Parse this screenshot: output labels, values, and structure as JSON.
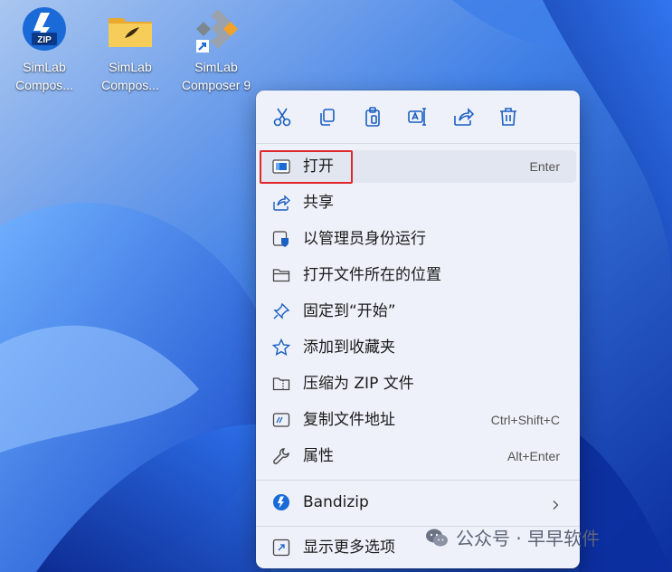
{
  "desktop": {
    "icons": [
      {
        "label": "SimLab\nCompos...",
        "icon": "zip-archive-icon",
        "badge": "ZIP"
      },
      {
        "label": "SimLab\nCompos...",
        "icon": "folder-icon"
      },
      {
        "label": "SimLab\nComposer 9",
        "icon": "simlab-app-icon"
      }
    ]
  },
  "menu": {
    "toolbar": [
      "cut-icon",
      "copy-icon",
      "paste-icon",
      "rename-icon",
      "share-icon",
      "delete-icon"
    ],
    "items": [
      {
        "label": "打开",
        "shortcut": "Enter",
        "icon": "open-icon"
      },
      {
        "label": "共享",
        "shortcut": "",
        "icon": "share-icon"
      },
      {
        "label": "以管理员身份运行",
        "shortcut": "",
        "icon": "admin-shield-icon"
      },
      {
        "label": "打开文件所在的位置",
        "shortcut": "",
        "icon": "folder-icon"
      },
      {
        "label": "固定到“开始”",
        "shortcut": "",
        "icon": "pin-icon"
      },
      {
        "label": "添加到收藏夹",
        "shortcut": "",
        "icon": "star-icon"
      },
      {
        "label": "压缩为 ZIP 文件",
        "shortcut": "",
        "icon": "zip-icon"
      },
      {
        "label": "复制文件地址",
        "shortcut": "Ctrl+Shift+C",
        "icon": "copy-path-icon"
      },
      {
        "label": "属性",
        "shortcut": "Alt+Enter",
        "icon": "wrench-icon"
      }
    ],
    "submenu": {
      "label": "Bandizip",
      "icon": "bandizip-icon"
    },
    "more": {
      "label": "显示更多选项",
      "icon": "show-more-icon"
    }
  },
  "watermark": {
    "text": "公众号 · 早早软件"
  },
  "colors": {
    "highlight_box": "#e0272b",
    "menu_bg": "#eef1f9",
    "accent": "#1a6ad8"
  }
}
